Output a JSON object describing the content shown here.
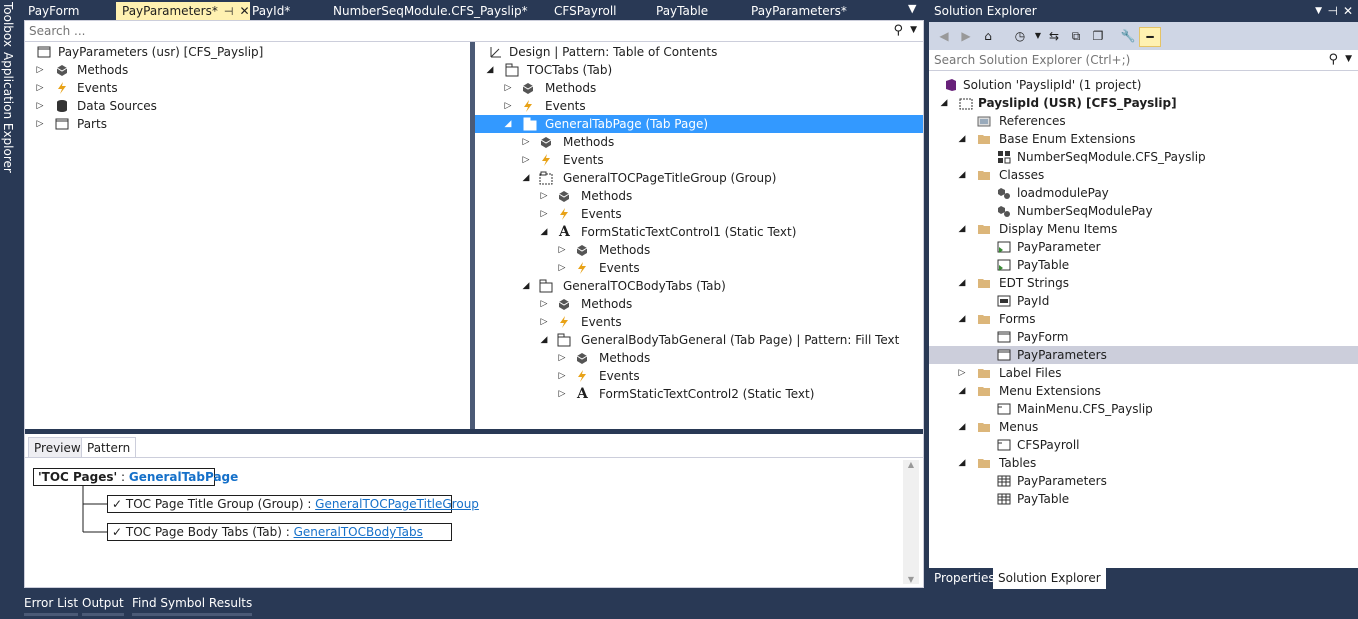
{
  "side_strip": {
    "toolbox": "Toolbox",
    "app_explorer": "Application Explorer"
  },
  "doc_tabs": [
    "PayForm",
    "PayParameters*",
    "PayId*",
    "NumberSeqModule.CFS_Payslip*",
    "CFSPayroll",
    "PayTable",
    "PayParameters*"
  ],
  "editor": {
    "search_placeholder": "Search ...",
    "left_tree": {
      "root": "PayParameters (usr) [CFS_Payslip]",
      "items": [
        "Methods",
        "Events",
        "Data Sources",
        "Parts"
      ]
    },
    "right_tree": {
      "root": "Design | Pattern: Table of Contents",
      "toc_tabs": "TOCTabs (Tab)",
      "methods": "Methods",
      "events": "Events",
      "general_tab_page": "GeneralTabPage (Tab Page)",
      "title_group": "GeneralTOCPageTitleGroup (Group)",
      "static_text1": "FormStaticTextControl1 (Static Text)",
      "body_tabs": "GeneralTOCBodyTabs (Tab)",
      "body_tab_general": "GeneralBodyTabGeneral (Tab Page) | Pattern: Fill Text",
      "static_text2": "FormStaticTextControl2 (Static Text)"
    },
    "bottom_tabs": [
      "Preview",
      "Pattern"
    ],
    "pattern": {
      "root_label": "'TOC Pages'",
      "root_sep": " : ",
      "root_link": "GeneralTabPage",
      "check": "✓",
      "rows": [
        {
          "label": "TOC Page Title Group  (Group)",
          "sep": "  :  ",
          "link": "GeneralTOCPageTitleGroup"
        },
        {
          "label": "TOC Page Body Tabs  (Tab)",
          "sep": "  :  ",
          "link": "GeneralTOCBodyTabs"
        }
      ]
    }
  },
  "solution_explorer": {
    "title": "Solution Explorer",
    "search_placeholder": "Search Solution Explorer (Ctrl+;)",
    "solution": "Solution 'PayslipId' (1 project)",
    "project": "PayslipId (USR) [CFS_Payslip]",
    "references": "References",
    "folders": {
      "base_enum_ext": "Base Enum Extensions",
      "base_enum_item": "NumberSeqModule.CFS_Payslip",
      "classes": "Classes",
      "class1": "loadmodulePay",
      "class2": "NumberSeqModulePay",
      "display_menu": "Display Menu Items",
      "dm1": "PayParameter",
      "dm2": "PayTable",
      "edt": "EDT Strings",
      "edt1": "PayId",
      "forms": "Forms",
      "form1": "PayForm",
      "form2": "PayParameters",
      "label_files": "Label Files",
      "menu_ext": "Menu Extensions",
      "menu_ext1": "MainMenu.CFS_Payslip",
      "menus": "Menus",
      "menus1": "CFSPayroll",
      "tables": "Tables",
      "table1": "PayParameters",
      "table2": "PayTable"
    },
    "bottom_tabs": [
      "Properties",
      "Solution Explorer"
    ]
  },
  "bottom_windows": [
    "Error List",
    "Output",
    "Find Symbol Results"
  ],
  "colors": {
    "accent": "#3399ff",
    "active_tab": "#fff1b1",
    "chrome": "#293955",
    "link": "#1570c9"
  }
}
